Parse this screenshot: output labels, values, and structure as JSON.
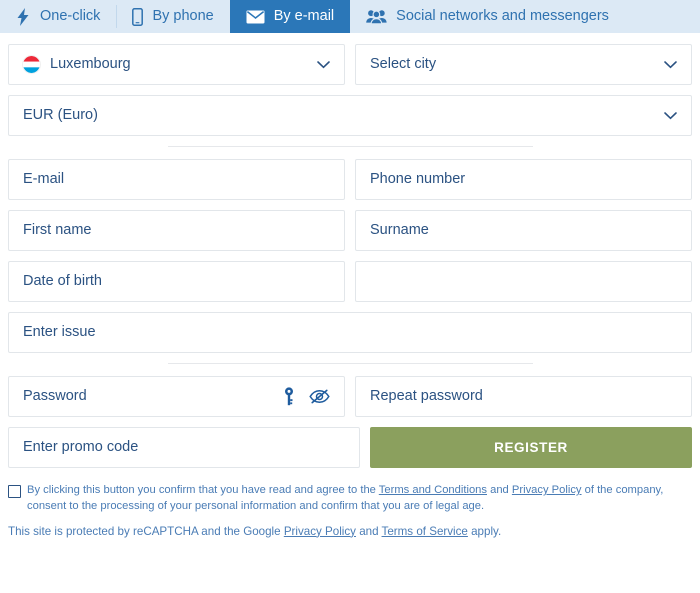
{
  "tabs": [
    {
      "label": "One-click",
      "icon": "lightning-bolt-icon",
      "active": false
    },
    {
      "label": "By phone",
      "icon": "mobile-phone-icon",
      "active": false
    },
    {
      "label": "By e-mail",
      "icon": "envelope-icon",
      "active": true
    },
    {
      "label": "Social networks and messengers",
      "icon": "people-group-icon",
      "active": false
    }
  ],
  "form": {
    "country": {
      "value": "Luxembourg",
      "flag": "luxembourg-flag-icon"
    },
    "city": {
      "placeholder": "Select city"
    },
    "currency": {
      "value": "EUR (Euro)"
    },
    "email": {
      "placeholder": "E-mail",
      "value": ""
    },
    "phone": {
      "placeholder": "Phone number",
      "value": ""
    },
    "first_name": {
      "placeholder": "First name",
      "value": ""
    },
    "surname": {
      "placeholder": "Surname",
      "value": ""
    },
    "date_of_birth": {
      "placeholder": "Date of birth",
      "value": ""
    },
    "extra": {
      "placeholder": "",
      "value": ""
    },
    "issue": {
      "placeholder": "Enter issue",
      "value": ""
    },
    "password": {
      "placeholder": "Password",
      "value": ""
    },
    "repeat_password": {
      "placeholder": "Repeat password",
      "value": ""
    },
    "promo_code": {
      "placeholder": "Enter promo code",
      "value": ""
    },
    "register_label": "REGISTER"
  },
  "terms": {
    "part1": "By clicking this button you confirm that you have read and agree to the ",
    "link1": "Terms and Conditions",
    "part2": " and ",
    "link2": "Privacy Policy",
    "part3": " of the company, consent to the processing of your personal information and confirm that you are of legal age."
  },
  "footer": {
    "part1": "This site is protected by reCAPTCHA and the Google ",
    "link1": "Privacy Policy",
    "part2": " and ",
    "link2": "Terms of Service",
    "part3": " apply."
  },
  "colors": {
    "tabbar_bg": "#dce9f5",
    "tab_active_bg": "#2b77b8",
    "text_blue": "#2b5282",
    "link_blue": "#4a7cb5",
    "register_green": "#8ba05e"
  }
}
